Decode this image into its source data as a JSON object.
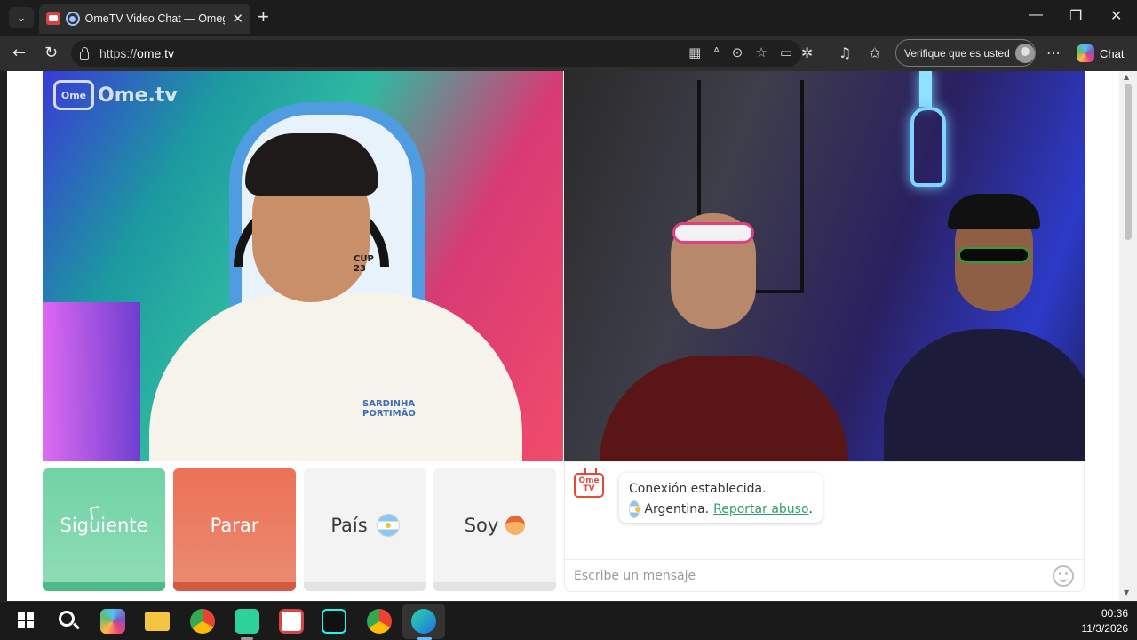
{
  "browser": {
    "tab_title": "OmeTV Video Chat — Omegle",
    "url_prefix": "https://",
    "url_domain": "ome.tv",
    "verify_label": "Verifique que es usted",
    "chat_label": "Chat",
    "new_tab_symbol": "+",
    "close_symbol": "✕"
  },
  "window_controls": {
    "minimize": "—",
    "restore": "❐",
    "close": "✕"
  },
  "videos": {
    "watermark_icon": "Ome",
    "watermark_text": "Ome.tv",
    "left_shirt_text": "SARDINHA\nPORTIMÃO",
    "left_chair_text": "CUP\n23"
  },
  "controls": {
    "next_label": "Siguiente",
    "stop_label": "Parar",
    "country_label": "País",
    "soy_label": "Soy",
    "country_flag": "flag-argentina-icon",
    "soy_icon": "boy-face-icon"
  },
  "chat": {
    "logo_text": "Ome\nTV",
    "message_line1": "Conexión establecida.",
    "country_name": "Argentina.",
    "report_link": "Reportar abuso",
    "report_suffix": ".",
    "input_placeholder": "Escribe un mensaje"
  },
  "taskbar": {
    "time": "00:36",
    "date": "11/3/2026"
  },
  "colors": {
    "next_green": "#6fd3a4",
    "stop_red": "#ec7157",
    "link_green": "#2e9e6a",
    "brand_red": "#e34a3a"
  }
}
